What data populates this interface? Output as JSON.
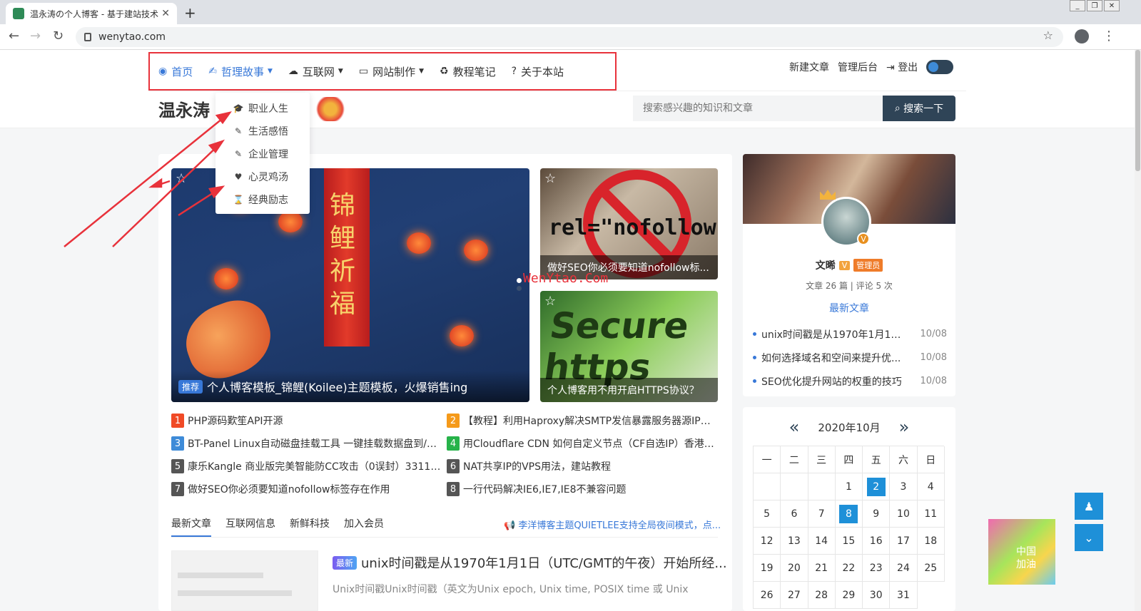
{
  "browser": {
    "tab_title": "温永涛の个人博客 - 基于建站技术",
    "url": "wenytao.com",
    "new_tab": "+",
    "close": "✕"
  },
  "nav": {
    "items": [
      {
        "label": "首页",
        "icon": "compass-icon",
        "glyph": "◉",
        "active": true,
        "dropdown": false
      },
      {
        "label": "哲理故事",
        "icon": "book-icon",
        "glyph": "✍",
        "active": true,
        "dropdown": true
      },
      {
        "label": "互联网",
        "icon": "cloud-icon",
        "glyph": "☁",
        "active": false,
        "dropdown": true
      },
      {
        "label": "网站制作",
        "icon": "desktop-icon",
        "glyph": "▭",
        "active": false,
        "dropdown": true
      },
      {
        "label": "教程笔记",
        "icon": "recycle-icon",
        "glyph": "♻",
        "active": false,
        "dropdown": false
      },
      {
        "label": "关于本站",
        "icon": "question-icon",
        "glyph": "?",
        "active": false,
        "dropdown": false
      }
    ],
    "right": {
      "new_post": "新建文章",
      "admin": "管理后台",
      "logout": "登出"
    }
  },
  "dropdown": [
    {
      "label": "职业人生",
      "glyph": "🎓",
      "icon": "graduation-cap-icon"
    },
    {
      "label": "生活感悟",
      "glyph": "✎",
      "icon": "leaf-icon"
    },
    {
      "label": "企业管理",
      "glyph": "✎",
      "icon": "edit-icon"
    },
    {
      "label": "心灵鸡汤",
      "glyph": "♥",
      "icon": "heartbeat-icon"
    },
    {
      "label": "经典励志",
      "glyph": "⌛",
      "icon": "hourglass-icon"
    }
  ],
  "header": {
    "logo": "温永涛",
    "search_placeholder": "搜索感兴趣的知识和文章",
    "search_button": "搜索一下"
  },
  "hero": {
    "badge": "推荐",
    "title": "个人博客模板_锦鲤(Koilee)主题模板，火爆销售ing",
    "banner_text": "锦鲤祈福"
  },
  "side_posts": [
    {
      "title": "做好SEO你必须要知道nofollow标...",
      "image_text": "rel=\"nofollow\""
    },
    {
      "title": "个人博客用不用开启HTTPS协议？",
      "image_text": "Secure https"
    }
  ],
  "watermark": "WenYtao.Com",
  "hot_list": [
    {
      "num": "1",
      "color": "#f04a26",
      "title": "PHP源码歎笙API开源"
    },
    {
      "num": "2",
      "color": "#f59a1a",
      "title": "【教程】利用Haproxy解决SMTP发信暴露服务器源IP的..."
    },
    {
      "num": "3",
      "color": "#3e8bd8",
      "title": "BT-Panel Linux自动磁盘挂载工具 一键挂载数据盘到/w..."
    },
    {
      "num": "4",
      "color": "#27b34a",
      "title": "用Cloudflare CDN 如何自定义节点（CF自选IP）香港/..."
    },
    {
      "num": "5",
      "color": "#555555",
      "title": "康乐Kangle 商业版完美智能防CC攻击（0误封）3311后..."
    },
    {
      "num": "6",
      "color": "#555555",
      "title": "NAT共享IP的VPS用法，建站教程"
    },
    {
      "num": "7",
      "color": "#555555",
      "title": "做好SEO你必须要知道nofollow标签存在作用"
    },
    {
      "num": "8",
      "color": "#555555",
      "title": "一行代码解决IE6,IE7,IE8不兼容问题"
    }
  ],
  "tabs": [
    "最新文章",
    "互联网信息",
    "新鲜科技",
    "加入会员"
  ],
  "notice": "📢 李洋博客主题QUIETLEE支持全局夜间模式，点...",
  "latest_post": {
    "badge": "最新",
    "title": "unix时间戳是从1970年1月1日（UTC/GMT的午夜）开始所经...",
    "excerpt": "Unix时间戳Unix时间戳（英文为Unix epoch, Unix time, POSIX time 或 Unix"
  },
  "profile": {
    "name": "文晞",
    "v": "V",
    "role": "管理员",
    "stats": "文章 26 篇 | 评论 5 次",
    "latest_title": "最新文章",
    "latest": [
      {
        "title": "unix时间戳是从1970年1月1日...",
        "date": "10/08"
      },
      {
        "title": "如何选择域名和空间来提升优...",
        "date": "10/08"
      },
      {
        "title": "SEO优化提升网站的权重的技巧",
        "date": "10/08"
      }
    ]
  },
  "calendar": {
    "prev": "«",
    "next": "»",
    "month": "2020年10月",
    "weekdays": [
      "一",
      "二",
      "三",
      "四",
      "五",
      "六",
      "日"
    ],
    "days": [
      "",
      "",
      "",
      "1",
      "2",
      "3",
      "4",
      "5",
      "6",
      "7",
      "8",
      "9",
      "10",
      "11",
      "12",
      "13",
      "14",
      "15",
      "16",
      "17",
      "18",
      "19",
      "20",
      "21",
      "22",
      "23",
      "24",
      "25",
      "26",
      "27",
      "28",
      "29",
      "30",
      "31"
    ],
    "highlighted": [
      "2",
      "8"
    ]
  },
  "floats": {
    "qq": "♟",
    "down": "⌄",
    "cube_text": "中国加油"
  },
  "colors": {
    "accent": "#3878d8",
    "annotation": "#e8323b",
    "dark": "#2f4457",
    "calendar_hl": "#1e90d8"
  }
}
